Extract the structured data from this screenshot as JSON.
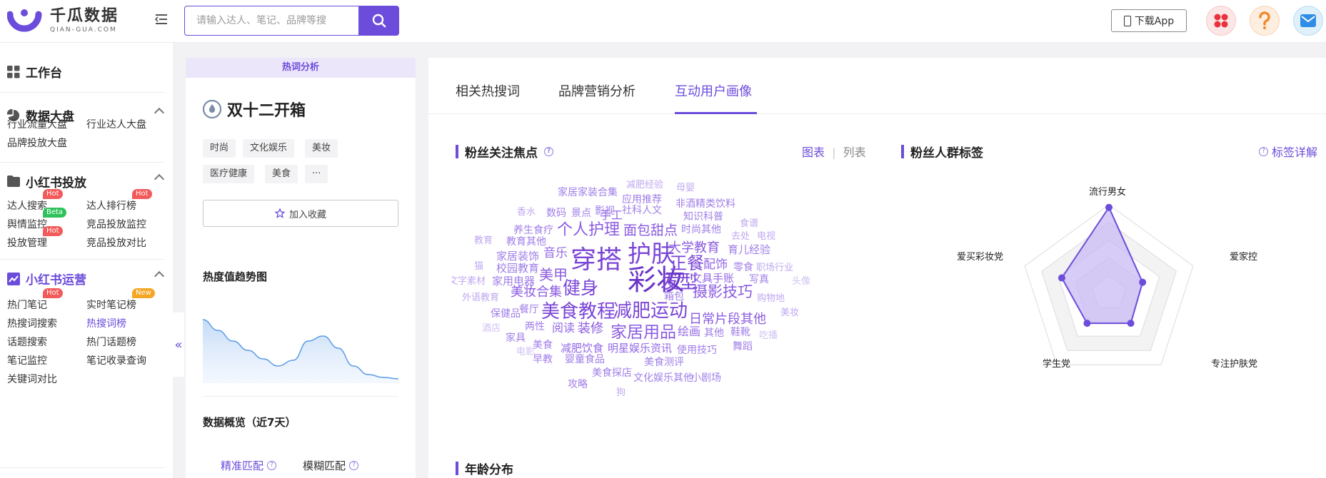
{
  "brand": {
    "name_cn": "千瓜数据",
    "name_en": "QIAN-GUA.COM"
  },
  "header": {
    "search_placeholder": "请输入达人、笔记、品牌等搜",
    "download_label": "下载App"
  },
  "sidebar": {
    "workbench": "工作台",
    "sections": [
      {
        "title": "数据大盘",
        "items": [
          {
            "label": "行业流量大盘"
          },
          {
            "label": "行业达人大盘"
          },
          {
            "label": "品牌投放大盘"
          }
        ]
      },
      {
        "title": "小红书投放",
        "items": [
          {
            "label": "达人搜索",
            "badge": "Hot"
          },
          {
            "label": "达人排行榜",
            "badge": "Hot"
          },
          {
            "label": "舆情监控",
            "badge": "Beta"
          },
          {
            "label": "竞品投放监控"
          },
          {
            "label": "投放管理",
            "badge": "Hot"
          },
          {
            "label": "竞品投放对比"
          }
        ]
      },
      {
        "title": "小红书运营",
        "items": [
          {
            "label": "热门笔记",
            "badge": "Hot"
          },
          {
            "label": "实时笔记榜",
            "badge": "New"
          },
          {
            "label": "热搜词搜索"
          },
          {
            "label": "热搜词榜"
          },
          {
            "label": "话题搜索"
          },
          {
            "label": "热门话题榜"
          },
          {
            "label": "笔记监控"
          },
          {
            "label": "笔记收录查询"
          },
          {
            "label": "关键词对比"
          }
        ]
      }
    ],
    "collapse_glyph": "«"
  },
  "keyword_panel": {
    "ribbon": "热词分析",
    "keyword": "双十二开箱",
    "tags": [
      "时尚",
      "文化娱乐",
      "美妆",
      "医疗健康",
      "美食",
      "···"
    ],
    "favorite_label": "加入收藏",
    "trend_title": "热度值趋势图",
    "overview_title": "数据概览（近7天）",
    "match_tabs": [
      {
        "label": "精准匹配",
        "active": true
      },
      {
        "label": "模糊匹配",
        "active": false
      }
    ]
  },
  "main": {
    "tabs": [
      {
        "label": "相关热搜词"
      },
      {
        "label": "品牌营销分析"
      },
      {
        "label": "互动用户画像",
        "active": true
      }
    ],
    "focus_title": "粉丝关注焦点",
    "view_toggle": {
      "chart": "图表",
      "sep": "|",
      "list": "列表"
    },
    "tags_title": "粉丝人群标签",
    "detail_label": "标签详解",
    "age_title": "年龄分布"
  },
  "wordcloud": {
    "words": [
      {
        "text": "彩妆",
        "size": 40,
        "color": "#6a35c9"
      },
      {
        "text": "穿搭",
        "size": 36,
        "color": "#7a45d6"
      },
      {
        "text": "护肤",
        "size": 33,
        "color": "#7a45d6"
      },
      {
        "text": "发型",
        "size": 26,
        "color": "#7a45d6"
      },
      {
        "text": "正餐",
        "size": 24,
        "color": "#7a45d6"
      },
      {
        "text": "减肥运动",
        "size": 26,
        "color": "#7a45d6"
      },
      {
        "text": "美食教程",
        "size": 26,
        "color": "#7a45d6"
      },
      {
        "text": "健身",
        "size": 25,
        "color": "#7a45d6"
      },
      {
        "text": "家居用品",
        "size": 23,
        "color": "#8a5ae0"
      },
      {
        "text": "摄影技巧",
        "size": 21,
        "color": "#8a5ae0"
      },
      {
        "text": "个人护理",
        "size": 22,
        "color": "#8a5ae0"
      },
      {
        "text": "美甲",
        "size": 20,
        "color": "#8a5ae0"
      },
      {
        "text": "面包甜点",
        "size": 19,
        "color": "#8a5ae0"
      },
      {
        "text": "大学教育",
        "size": 18,
        "color": "#8a5ae0"
      },
      {
        "text": "日常片段其他",
        "size": 18,
        "color": "#8a5ae0"
      },
      {
        "text": "美妆合集",
        "size": 18,
        "color": "#8a5ae0"
      },
      {
        "text": "装修",
        "size": 18,
        "color": "#8a5ae0"
      },
      {
        "text": "音乐",
        "size": 17,
        "color": "#9468e6"
      },
      {
        "text": "配饰",
        "size": 17,
        "color": "#9468e6"
      },
      {
        "text": "手工",
        "size": 16,
        "color": "#9468e6"
      },
      {
        "text": "阅读",
        "size": 16,
        "color": "#9468e6"
      },
      {
        "text": "绘画",
        "size": 16,
        "color": "#9468e6"
      },
      {
        "text": "减肥饮食",
        "size": 15,
        "color": "#9468e6"
      },
      {
        "text": "明星娱乐资讯",
        "size": 15,
        "color": "#9468e6"
      },
      {
        "text": "文具手账",
        "size": 15,
        "color": "#9468e6"
      },
      {
        "text": "家居装饰",
        "size": 15,
        "color": "#a07ee8"
      },
      {
        "text": "校园教育",
        "size": 15,
        "color": "#a07ee8"
      },
      {
        "text": "家用电器",
        "size": 15,
        "color": "#a07ee8"
      },
      {
        "text": "教育其他",
        "size": 14,
        "color": "#a07ee8"
      },
      {
        "text": "养生食疗",
        "size": 14,
        "color": "#a07ee8"
      },
      {
        "text": "影视",
        "size": 14,
        "color": "#a07ee8"
      },
      {
        "text": "社科人文",
        "size": 14,
        "color": "#a07ee8"
      },
      {
        "text": "应用推荐",
        "size": 14,
        "color": "#a07ee8"
      },
      {
        "text": "家居家装合集",
        "size": 14,
        "color": "#a07ee8"
      },
      {
        "text": "数码",
        "size": 14,
        "color": "#a07ee8"
      },
      {
        "text": "景点",
        "size": 14,
        "color": "#a07ee8"
      },
      {
        "text": "非酒精类饮料",
        "size": 14,
        "color": "#a07ee8"
      },
      {
        "text": "知识科普",
        "size": 14,
        "color": "#a07ee8"
      },
      {
        "text": "时尚其他",
        "size": 14,
        "color": "#a07ee8"
      },
      {
        "text": "育儿经验",
        "size": 15,
        "color": "#a07ee8"
      },
      {
        "text": "零食",
        "size": 14,
        "color": "#a07ee8"
      },
      {
        "text": "写真",
        "size": 14,
        "color": "#a07ee8"
      },
      {
        "text": "箱包",
        "size": 14,
        "color": "#a07ee8"
      },
      {
        "text": "餐厅",
        "size": 14,
        "color": "#a07ee8"
      },
      {
        "text": "保健品",
        "size": 14,
        "color": "#a07ee8"
      },
      {
        "text": "两性",
        "size": 14,
        "color": "#a07ee8"
      },
      {
        "text": "其他",
        "size": 14,
        "color": "#a07ee8"
      },
      {
        "text": "鞋靴",
        "size": 14,
        "color": "#a07ee8"
      },
      {
        "text": "使用技巧",
        "size": 14,
        "color": "#a07ee8"
      },
      {
        "text": "舞蹈",
        "size": 14,
        "color": "#a07ee8"
      },
      {
        "text": "美食",
        "size": 14,
        "color": "#a07ee8"
      },
      {
        "text": "婴童食品",
        "size": 14,
        "color": "#a07ee8"
      },
      {
        "text": "美食测评",
        "size": 14,
        "color": "#a07ee8"
      },
      {
        "text": "早教",
        "size": 14,
        "color": "#a07ee8"
      },
      {
        "text": "美食探店",
        "size": 14,
        "color": "#a07ee8"
      },
      {
        "text": "小剧场",
        "size": 14,
        "color": "#a07ee8"
      },
      {
        "text": "文化娱乐其他",
        "size": 14,
        "color": "#a07ee8"
      },
      {
        "text": "攻略",
        "size": 14,
        "color": "#a07ee8"
      },
      {
        "text": "家具",
        "size": 14,
        "color": "#a07ee8"
      },
      {
        "text": "减肥经验",
        "size": 13,
        "color": "#c0a8f0"
      },
      {
        "text": "母婴",
        "size": 13,
        "color": "#c0a8f0"
      },
      {
        "text": "香水",
        "size": 13,
        "color": "#c0a8f0"
      },
      {
        "text": "食谱",
        "size": 13,
        "color": "#c0a8f0"
      },
      {
        "text": "电视",
        "size": 13,
        "color": "#c0a8f0"
      },
      {
        "text": "去处",
        "size": 13,
        "color": "#c0a8f0"
      },
      {
        "text": "教育",
        "size": 13,
        "color": "#c0a8f0"
      },
      {
        "text": "职场行业",
        "size": 13,
        "color": "#c0a8f0"
      },
      {
        "text": "猫",
        "size": 13,
        "color": "#c0a8f0"
      },
      {
        "text": "文字素材",
        "size": 13,
        "color": "#c0a8f0"
      },
      {
        "text": "头像",
        "size": 13,
        "color": "#d0c0f2"
      },
      {
        "text": "外语教育",
        "size": 13,
        "color": "#c0a8f0"
      },
      {
        "text": "购物地",
        "size": 13,
        "color": "#c0a8f0"
      },
      {
        "text": "美妆",
        "size": 13,
        "color": "#c0a8f0"
      },
      {
        "text": "酒店",
        "size": 13,
        "color": "#d0c0f2"
      },
      {
        "text": "吃播",
        "size": 13,
        "color": "#d0c0f2"
      },
      {
        "text": "电影",
        "size": 13,
        "color": "#d0c0f2"
      },
      {
        "text": "狗",
        "size": 13,
        "color": "#c0a8f0"
      }
    ]
  },
  "radar": {
    "axes": [
      {
        "label": "流行男女",
        "value": 0.97
      },
      {
        "label": "爱家控",
        "value": 0.4
      },
      {
        "label": "专注护肤党",
        "value": 0.42
      },
      {
        "label": "学生党",
        "value": 0.42
      },
      {
        "label": "爱买彩妆党",
        "value": 0.56
      }
    ],
    "colors": {
      "line": "#6c4cdb",
      "fill": "#c6b5f3",
      "ring1": "#ffffff",
      "ring2": "#f3f3f3"
    }
  },
  "trend": {
    "values": [
      0.85,
      0.7,
      0.55,
      0.42,
      0.3,
      0.2,
      0.28,
      0.55,
      0.62,
      0.45,
      0.2,
      0.08,
      0.04,
      0.02
    ]
  },
  "colors": {
    "accent": "#6c4cdb",
    "hot": "#f35a5a",
    "beta": "#2fc25b",
    "new": "#f5a623"
  }
}
